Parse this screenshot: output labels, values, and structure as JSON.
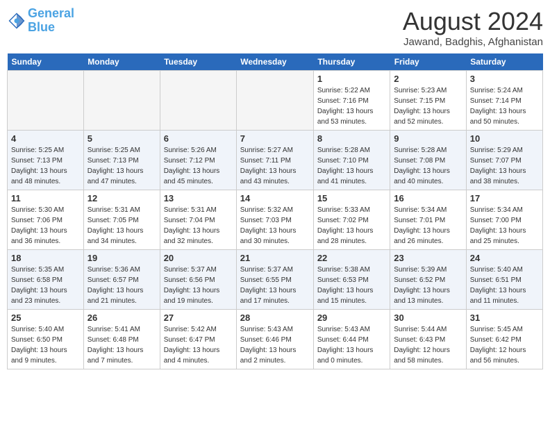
{
  "header": {
    "logo_line1": "General",
    "logo_line2": "Blue",
    "month_year": "August 2024",
    "location": "Jawand, Badghis, Afghanistan"
  },
  "weekdays": [
    "Sunday",
    "Monday",
    "Tuesday",
    "Wednesday",
    "Thursday",
    "Friday",
    "Saturday"
  ],
  "weeks": [
    {
      "class": "row-week1",
      "days": [
        {
          "num": "",
          "info": ""
        },
        {
          "num": "",
          "info": ""
        },
        {
          "num": "",
          "info": ""
        },
        {
          "num": "",
          "info": ""
        },
        {
          "num": "1",
          "info": "Sunrise: 5:22 AM\nSunset: 7:16 PM\nDaylight: 13 hours\nand 53 minutes."
        },
        {
          "num": "2",
          "info": "Sunrise: 5:23 AM\nSunset: 7:15 PM\nDaylight: 13 hours\nand 52 minutes."
        },
        {
          "num": "3",
          "info": "Sunrise: 5:24 AM\nSunset: 7:14 PM\nDaylight: 13 hours\nand 50 minutes."
        }
      ]
    },
    {
      "class": "row-week2",
      "days": [
        {
          "num": "4",
          "info": "Sunrise: 5:25 AM\nSunset: 7:13 PM\nDaylight: 13 hours\nand 48 minutes."
        },
        {
          "num": "5",
          "info": "Sunrise: 5:25 AM\nSunset: 7:13 PM\nDaylight: 13 hours\nand 47 minutes."
        },
        {
          "num": "6",
          "info": "Sunrise: 5:26 AM\nSunset: 7:12 PM\nDaylight: 13 hours\nand 45 minutes."
        },
        {
          "num": "7",
          "info": "Sunrise: 5:27 AM\nSunset: 7:11 PM\nDaylight: 13 hours\nand 43 minutes."
        },
        {
          "num": "8",
          "info": "Sunrise: 5:28 AM\nSunset: 7:10 PM\nDaylight: 13 hours\nand 41 minutes."
        },
        {
          "num": "9",
          "info": "Sunrise: 5:28 AM\nSunset: 7:08 PM\nDaylight: 13 hours\nand 40 minutes."
        },
        {
          "num": "10",
          "info": "Sunrise: 5:29 AM\nSunset: 7:07 PM\nDaylight: 13 hours\nand 38 minutes."
        }
      ]
    },
    {
      "class": "row-week3",
      "days": [
        {
          "num": "11",
          "info": "Sunrise: 5:30 AM\nSunset: 7:06 PM\nDaylight: 13 hours\nand 36 minutes."
        },
        {
          "num": "12",
          "info": "Sunrise: 5:31 AM\nSunset: 7:05 PM\nDaylight: 13 hours\nand 34 minutes."
        },
        {
          "num": "13",
          "info": "Sunrise: 5:31 AM\nSunset: 7:04 PM\nDaylight: 13 hours\nand 32 minutes."
        },
        {
          "num": "14",
          "info": "Sunrise: 5:32 AM\nSunset: 7:03 PM\nDaylight: 13 hours\nand 30 minutes."
        },
        {
          "num": "15",
          "info": "Sunrise: 5:33 AM\nSunset: 7:02 PM\nDaylight: 13 hours\nand 28 minutes."
        },
        {
          "num": "16",
          "info": "Sunrise: 5:34 AM\nSunset: 7:01 PM\nDaylight: 13 hours\nand 26 minutes."
        },
        {
          "num": "17",
          "info": "Sunrise: 5:34 AM\nSunset: 7:00 PM\nDaylight: 13 hours\nand 25 minutes."
        }
      ]
    },
    {
      "class": "row-week4",
      "days": [
        {
          "num": "18",
          "info": "Sunrise: 5:35 AM\nSunset: 6:58 PM\nDaylight: 13 hours\nand 23 minutes."
        },
        {
          "num": "19",
          "info": "Sunrise: 5:36 AM\nSunset: 6:57 PM\nDaylight: 13 hours\nand 21 minutes."
        },
        {
          "num": "20",
          "info": "Sunrise: 5:37 AM\nSunset: 6:56 PM\nDaylight: 13 hours\nand 19 minutes."
        },
        {
          "num": "21",
          "info": "Sunrise: 5:37 AM\nSunset: 6:55 PM\nDaylight: 13 hours\nand 17 minutes."
        },
        {
          "num": "22",
          "info": "Sunrise: 5:38 AM\nSunset: 6:53 PM\nDaylight: 13 hours\nand 15 minutes."
        },
        {
          "num": "23",
          "info": "Sunrise: 5:39 AM\nSunset: 6:52 PM\nDaylight: 13 hours\nand 13 minutes."
        },
        {
          "num": "24",
          "info": "Sunrise: 5:40 AM\nSunset: 6:51 PM\nDaylight: 13 hours\nand 11 minutes."
        }
      ]
    },
    {
      "class": "row-week5",
      "days": [
        {
          "num": "25",
          "info": "Sunrise: 5:40 AM\nSunset: 6:50 PM\nDaylight: 13 hours\nand 9 minutes."
        },
        {
          "num": "26",
          "info": "Sunrise: 5:41 AM\nSunset: 6:48 PM\nDaylight: 13 hours\nand 7 minutes."
        },
        {
          "num": "27",
          "info": "Sunrise: 5:42 AM\nSunset: 6:47 PM\nDaylight: 13 hours\nand 4 minutes."
        },
        {
          "num": "28",
          "info": "Sunrise: 5:43 AM\nSunset: 6:46 PM\nDaylight: 13 hours\nand 2 minutes."
        },
        {
          "num": "29",
          "info": "Sunrise: 5:43 AM\nSunset: 6:44 PM\nDaylight: 13 hours\nand 0 minutes."
        },
        {
          "num": "30",
          "info": "Sunrise: 5:44 AM\nSunset: 6:43 PM\nDaylight: 12 hours\nand 58 minutes."
        },
        {
          "num": "31",
          "info": "Sunrise: 5:45 AM\nSunset: 6:42 PM\nDaylight: 12 hours\nand 56 minutes."
        }
      ]
    }
  ]
}
